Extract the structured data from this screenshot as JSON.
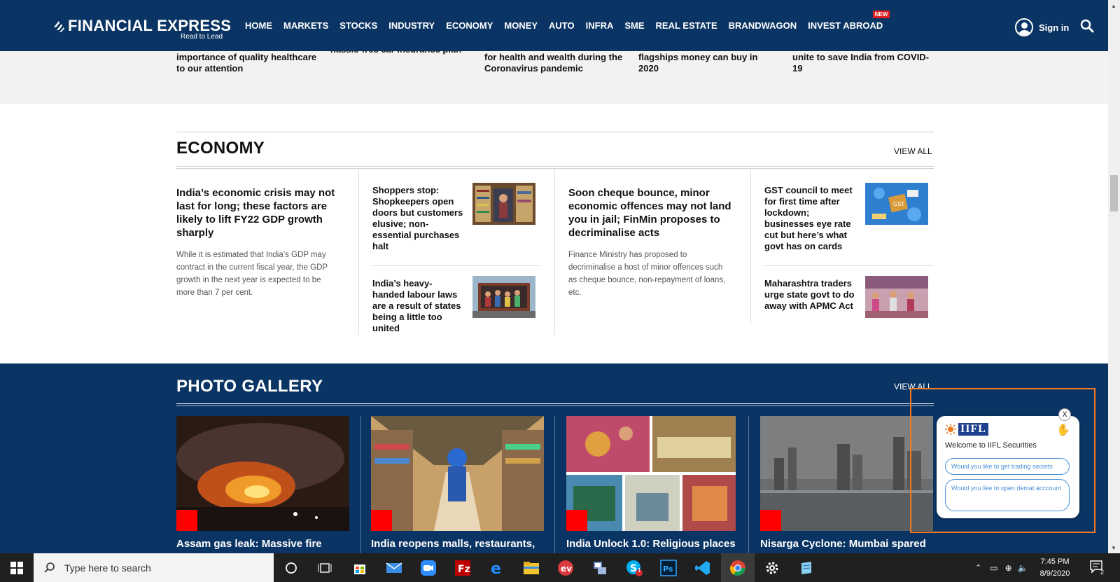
{
  "header": {
    "logo_text": "FINANCIAL EXPRESS",
    "tagline": "Read to Lead",
    "nav": [
      "HOME",
      "MARKETS",
      "STOCKS",
      "INDUSTRY",
      "ECONOMY",
      "MONEY",
      "AUTO",
      "INFRA",
      "SME",
      "REAL ESTATE",
      "BRANDWAGON",
      "INVEST ABROAD"
    ],
    "new_badge": "NEW",
    "signin": "Sign in"
  },
  "prev_section": {
    "items": [
      "importance of quality healthcare to our attention",
      "hassle-free car insurance plan",
      "for health and wealth during the Coronavirus pandemic",
      "flagships money can buy in 2020",
      "unite to save India from COVID-19"
    ]
  },
  "economy": {
    "title": "ECONOMY",
    "view_all": "VIEW ALL",
    "lead1": {
      "headline": "India’s economic crisis may not last for long; these factors are likely to lift FY22 GDP growth sharply",
      "desc": "While it is estimated that India’s GDP may contract in the current fiscal year, the GDP growth in the next year is expected to be more than 7 per cent."
    },
    "small1": {
      "headline": "Shoppers stop: Shopkeepers open doors but customers elusive; non-essential purchases halt"
    },
    "small2": {
      "headline": "India’s heavy-handed labour laws are a result of states being a little too united"
    },
    "lead2": {
      "headline": "Soon cheque bounce, minor economic offences may not land you in jail; FinMin proposes to decriminalise acts",
      "desc": "Finance Ministry has proposed to decriminalise a host of minor offences such as cheque bounce, non-repayment of loans, etc."
    },
    "small3": {
      "headline": "GST council to meet for first time after lockdown; businesses eye rate cut but here’s what govt has on cards"
    },
    "small4": {
      "headline": "Maharashtra traders urge state govt to do away with APMC Act"
    }
  },
  "gallery": {
    "title": "PHOTO GALLERY",
    "view_all": "VIEW ALL",
    "captions": [
      "Assam gas leak: Massive fire",
      "India reopens malls, restaurants,",
      "India Unlock 1.0: Religious places",
      "Nisarga Cyclone: Mumbai spared"
    ]
  },
  "chat": {
    "close": "X",
    "brand": "IIFL",
    "welcome": "Welcome to IIFL Securities",
    "option1": "Would you like to get trading secrets",
    "option2": "Would you like to open demat acccount"
  },
  "taskbar": {
    "search_placeholder": "Type here to search",
    "time": "7:45 PM",
    "date": "8/9/2020",
    "notification_count": "2",
    "skype_badge": "1"
  },
  "colors": {
    "navy": "#0a3463",
    "accent_red": "#ff0000",
    "widget_border": "#f07a23"
  }
}
